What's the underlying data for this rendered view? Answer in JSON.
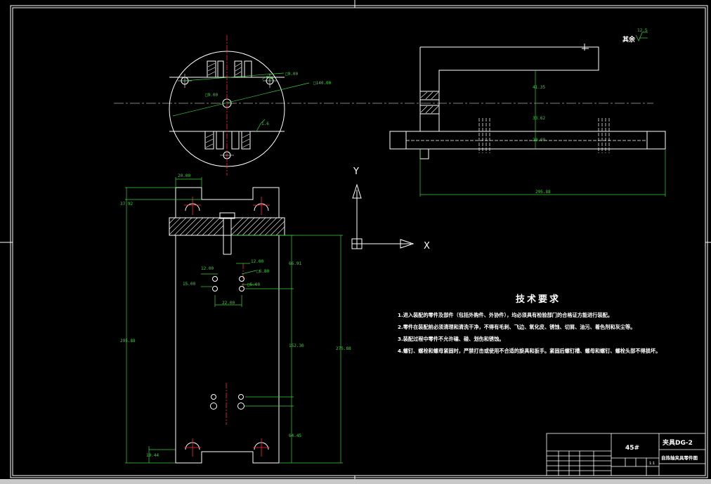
{
  "drawing": {
    "roughness_label": "其余",
    "roughness_symbol": "12.5",
    "roughness_marks": [
      "1.6",
      "1.6"
    ],
    "circle_view_dims": [
      "□9.00",
      "□9.00",
      "□140.00"
    ],
    "top_view_dims": [
      "41.35",
      "33.62",
      "20.00",
      "295.88"
    ],
    "front_view_dims": [
      "20.00",
      "37.92",
      "295.88",
      "275.88",
      "12.00",
      "12.00",
      "15.00",
      "□6.80",
      "□5.00",
      "22.00",
      "66.91",
      "152.30",
      "64.45",
      "19.44"
    ],
    "axis_x": "X",
    "axis_y": "Y"
  },
  "notes": {
    "title": "技术要求",
    "items": [
      "1.进入装配的零件及部件（包括外购件、外协件），均必须具有检验部门的合格证方能进行装配。",
      "2.零件在装配前必须清理和清洗干净，不得有毛刺、飞边、氧化皮、锈蚀、切屑、油污、着色剂和灰尘等。",
      "3.装配过程中零件不允许磕、碰、划伤和锈蚀。",
      "4.螺钉、螺栓和螺母紧固时，严禁打击或使用不合适的旋具和扳手。紧固后螺钉槽、螺母和螺钉、螺栓头部不得损坏。"
    ]
  },
  "title_block": {
    "material": "45#",
    "drawing_no": "夹具DG-2",
    "drawing_name": "自热轴夹具零件图",
    "scale": "1:1"
  },
  "colors": {
    "outline": "#ffffff",
    "dimension": "#3bd13b",
    "center": "#ff2a2a",
    "background": "#000000"
  }
}
